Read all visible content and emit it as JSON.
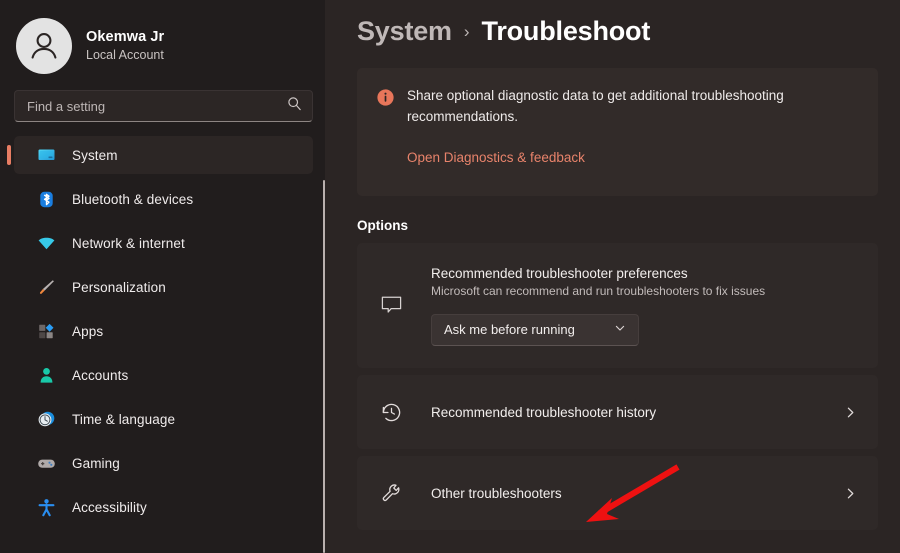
{
  "account": {
    "name": "Okemwa Jr",
    "subtitle": "Local Account",
    "avatar_icon": "person-avatar-icon"
  },
  "search": {
    "placeholder": "Find a setting",
    "icon": "search-icon"
  },
  "sidebar": {
    "items": [
      {
        "label": "System",
        "icon": "monitor-icon",
        "active": true
      },
      {
        "label": "Bluetooth & devices",
        "icon": "bluetooth-icon",
        "active": false
      },
      {
        "label": "Network & internet",
        "icon": "wifi-icon",
        "active": false
      },
      {
        "label": "Personalization",
        "icon": "paintbrush-icon",
        "active": false
      },
      {
        "label": "Apps",
        "icon": "apps-grid-icon",
        "active": false
      },
      {
        "label": "Accounts",
        "icon": "person-icon",
        "active": false
      },
      {
        "label": "Time & language",
        "icon": "clock-icon",
        "active": false
      },
      {
        "label": "Gaming",
        "icon": "gamepad-icon",
        "active": false
      },
      {
        "label": "Accessibility",
        "icon": "accessibility-icon",
        "active": false
      }
    ]
  },
  "breadcrumb": {
    "parent": "System",
    "separator": "›",
    "current": "Troubleshoot"
  },
  "banner": {
    "icon": "info-circle-icon",
    "message": "Share optional diagnostic data to get additional troubleshooting recommendations.",
    "link_label": "Open Diagnostics & feedback"
  },
  "options": {
    "section_label": "Options",
    "preference_card": {
      "icon": "speech-bubble-icon",
      "title": "Recommended troubleshooter preferences",
      "subtitle": "Microsoft can recommend and run troubleshooters to fix issues",
      "dropdown": {
        "value": "Ask me before running",
        "chevron_icon": "chevron-down-icon",
        "options": [
          "Ask me before running"
        ]
      }
    },
    "rows": [
      {
        "icon": "history-clock-icon",
        "title": "Recommended troubleshooter history",
        "chevron_icon": "chevron-right-icon"
      },
      {
        "icon": "wrench-icon",
        "title": "Other troubleshooters",
        "chevron_icon": "chevron-right-icon"
      }
    ]
  },
  "annotation": {
    "type": "arrow",
    "color": "#ee1111",
    "points_at": "Other troubleshooters"
  },
  "colors": {
    "accent": "#e87d63",
    "sidebar_bg": "#211d1d",
    "main_bg": "#2b2524",
    "card_bg": "#2f2928",
    "annotation_red": "#ee1111"
  }
}
